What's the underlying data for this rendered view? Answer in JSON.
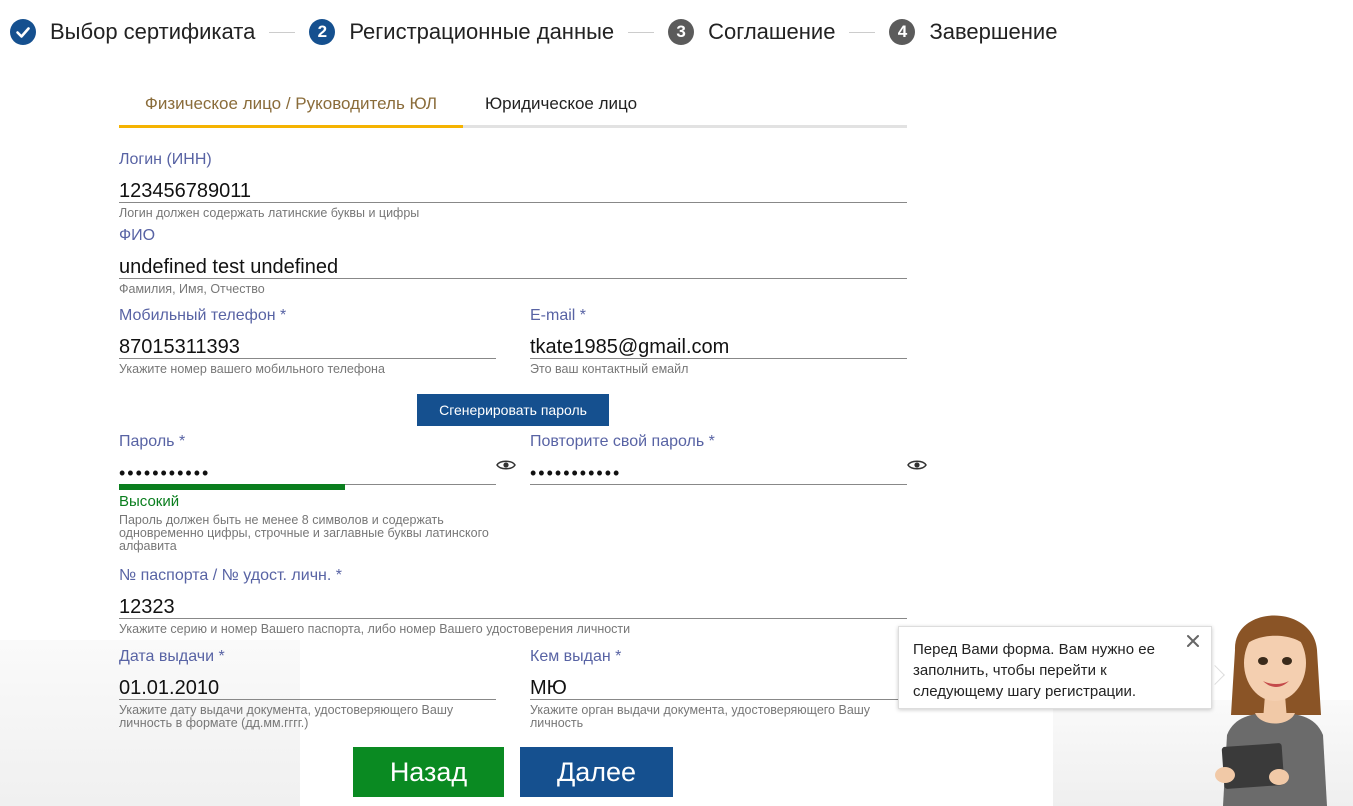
{
  "stepper": {
    "steps": [
      {
        "number": "",
        "label": "Выбор сертификата",
        "state": "done"
      },
      {
        "number": "2",
        "label": "Регистрационные данные",
        "state": "active"
      },
      {
        "number": "3",
        "label": "Соглашение",
        "state": "todo"
      },
      {
        "number": "4",
        "label": "Завершение",
        "state": "todo"
      }
    ]
  },
  "tabs": {
    "individual": "Физическое лицо / Руководитель ЮЛ",
    "legal": "Юридическое лицо"
  },
  "form": {
    "login": {
      "label": "Логин (ИНН)",
      "value": "123456789011",
      "hint": "Логин должен содержать латинские буквы и цифры"
    },
    "fio": {
      "label": "ФИО",
      "value": "undefined test undefined",
      "hint": "Фамилия, Имя, Отчество"
    },
    "phone": {
      "label": "Мобильный телефон *",
      "value": "87015311393",
      "hint": "Укажите номер вашего мобильного телефона"
    },
    "email": {
      "label": "E-mail *",
      "value": "tkate1985@gmail.com",
      "hint": "Это ваш контактный емайл"
    },
    "generate_button": "Сгенерировать пароль",
    "password": {
      "label": "Пароль *",
      "value": "•••••••••••",
      "strength_label": "Высокий",
      "strength_fraction": 0.6,
      "hint": "Пароль должен быть не менее 8 символов и содержать одновременно цифры, строчные и заглавные буквы латинского алфавита"
    },
    "password_repeat": {
      "label": "Повторите свой пароль *",
      "value": "•••••••••••"
    },
    "passport": {
      "label": "№ паспорта / № удост. личн. *",
      "value": "12323",
      "hint": "Укажите серию и номер Вашего паспорта, либо номер Вашего удостоверения личности"
    },
    "issue_date": {
      "label": "Дата выдачи *",
      "value": "01.01.2010",
      "hint": "Укажите дату выдачи документа, удостоверяющего Вашу личность в формате (дд.мм.гггг.)"
    },
    "issued_by": {
      "label": "Кем выдан *",
      "value": "МЮ",
      "hint": "Укажите орган выдачи документа, удостоверяющего Вашу личность"
    }
  },
  "buttons": {
    "back": "Назад",
    "next": "Далее"
  },
  "tooltip": {
    "text": "Перед Вами форма. Вам нужно ее заполнить, чтобы перейти к следующему шагу регистрации."
  },
  "colors": {
    "primary": "#15508f",
    "success": "#0a8a22",
    "tab_accent": "#f5b301",
    "label": "#5863a4"
  }
}
